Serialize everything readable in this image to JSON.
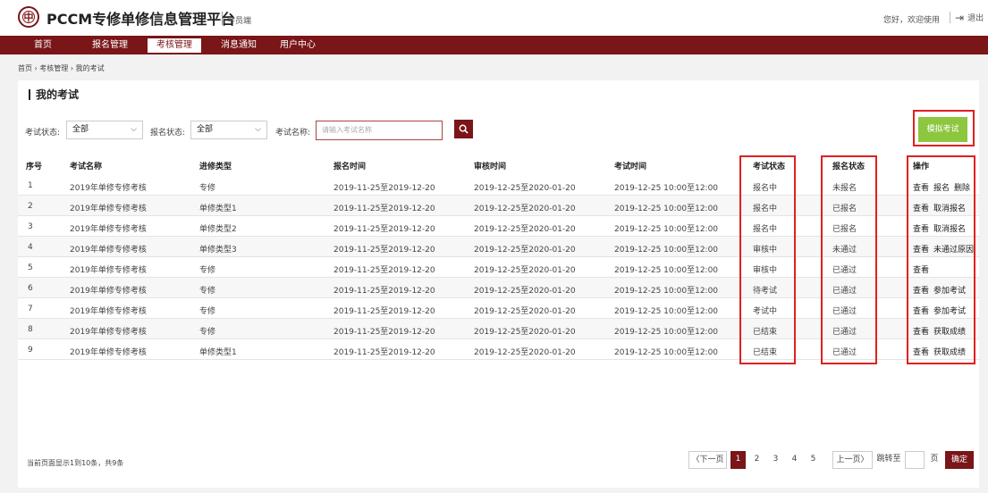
{
  "header": {
    "logo_glyph": "中",
    "title": "PCCM专修单修信息管理平台",
    "subtitle": "学员端",
    "greeting": "您好，欢迎使用",
    "logout": "退出"
  },
  "nav": {
    "items": [
      {
        "label": "首页"
      },
      {
        "label": "报名管理"
      },
      {
        "label": "考核管理"
      },
      {
        "label": "消息通知"
      },
      {
        "label": "用户中心"
      }
    ],
    "active_index": 2
  },
  "breadcrumb": "首页 › 考核管理 › 我的考试",
  "panel": {
    "title": "我的考试",
    "filters": {
      "exam_status_label": "考试状态:",
      "exam_status_value": "全部",
      "reg_status_label": "报名状态:",
      "reg_status_value": "全部",
      "exam_name_label": "考试名称:",
      "exam_name_placeholder": "请输入考试名称"
    },
    "mock_exam_button": "模拟考试"
  },
  "table": {
    "headers": [
      "序号",
      "考试名称",
      "进修类型",
      "报名时间",
      "审核时间",
      "考试时间",
      "考试状态",
      "报名状态",
      "操作"
    ],
    "rows": [
      {
        "no": "1",
        "name": "2019年单修专修考核",
        "type": "专修",
        "reg_time": "2019-11-25至2019-12-20",
        "audit_time": "2019-12-25至2020-01-20",
        "exam_time": "2019-12-25 10:00至12:00",
        "exam_status": "报名中",
        "reg_status": "未报名",
        "ops": [
          "查看",
          "报名",
          "删除"
        ]
      },
      {
        "no": "2",
        "name": "2019年单修专修考核",
        "type": "单修类型1",
        "reg_time": "2019-11-25至2019-12-20",
        "audit_time": "2019-12-25至2020-01-20",
        "exam_time": "2019-12-25 10:00至12:00",
        "exam_status": "报名中",
        "reg_status": "已报名",
        "ops": [
          "查看",
          "取消报名"
        ]
      },
      {
        "no": "3",
        "name": "2019年单修专修考核",
        "type": "单修类型2",
        "reg_time": "2019-11-25至2019-12-20",
        "audit_time": "2019-12-25至2020-01-20",
        "exam_time": "2019-12-25 10:00至12:00",
        "exam_status": "报名中",
        "reg_status": "已报名",
        "ops": [
          "查看",
          "取消报名"
        ]
      },
      {
        "no": "4",
        "name": "2019年单修专修考核",
        "type": "单修类型3",
        "reg_time": "2019-11-25至2019-12-20",
        "audit_time": "2019-12-25至2020-01-20",
        "exam_time": "2019-12-25 10:00至12:00",
        "exam_status": "审核中",
        "reg_status": "未通过",
        "ops": [
          "查看",
          "未通过原因"
        ]
      },
      {
        "no": "5",
        "name": "2019年单修专修考核",
        "type": "专修",
        "reg_time": "2019-11-25至2019-12-20",
        "audit_time": "2019-12-25至2020-01-20",
        "exam_time": "2019-12-25 10:00至12:00",
        "exam_status": "审核中",
        "reg_status": "已通过",
        "ops": [
          "查看"
        ]
      },
      {
        "no": "6",
        "name": "2019年单修专修考核",
        "type": "专修",
        "reg_time": "2019-11-25至2019-12-20",
        "audit_time": "2019-12-25至2020-01-20",
        "exam_time": "2019-12-25 10:00至12:00",
        "exam_status": "待考试",
        "reg_status": "已通过",
        "ops": [
          "查看",
          "参加考试"
        ]
      },
      {
        "no": "7",
        "name": "2019年单修专修考核",
        "type": "专修",
        "reg_time": "2019-11-25至2019-12-20",
        "audit_time": "2019-12-25至2020-01-20",
        "exam_time": "2019-12-25 10:00至12:00",
        "exam_status": "考试中",
        "reg_status": "已通过",
        "ops": [
          "查看",
          "参加考试"
        ]
      },
      {
        "no": "8",
        "name": "2019年单修专修考核",
        "type": "专修",
        "reg_time": "2019-11-25至2019-12-20",
        "audit_time": "2019-12-25至2020-01-20",
        "exam_time": "2019-12-25 10:00至12:00",
        "exam_status": "已结束",
        "reg_status": "已通过",
        "ops": [
          "查看",
          "获取成绩"
        ]
      },
      {
        "no": "9",
        "name": "2019年单修专修考核",
        "type": "单修类型1",
        "reg_time": "2019-11-25至2019-12-20",
        "audit_time": "2019-12-25至2020-01-20",
        "exam_time": "2019-12-25 10:00至12:00",
        "exam_status": "已结束",
        "reg_status": "已通过",
        "ops": [
          "查看",
          "获取成绩"
        ]
      }
    ]
  },
  "footer": {
    "info": "当前页面显示1到10条，共9条",
    "next_page": "〈下一页",
    "pages": [
      "1",
      "2",
      "3",
      "4",
      "5"
    ],
    "current_page": "1",
    "prev_page": "上一页〉",
    "jump_label": "跳转至",
    "page_unit": "页",
    "confirm": "确定"
  },
  "colors": {
    "brand": "#7a1518",
    "mock_button": "#8dc63f",
    "highlight": "#e02020"
  }
}
